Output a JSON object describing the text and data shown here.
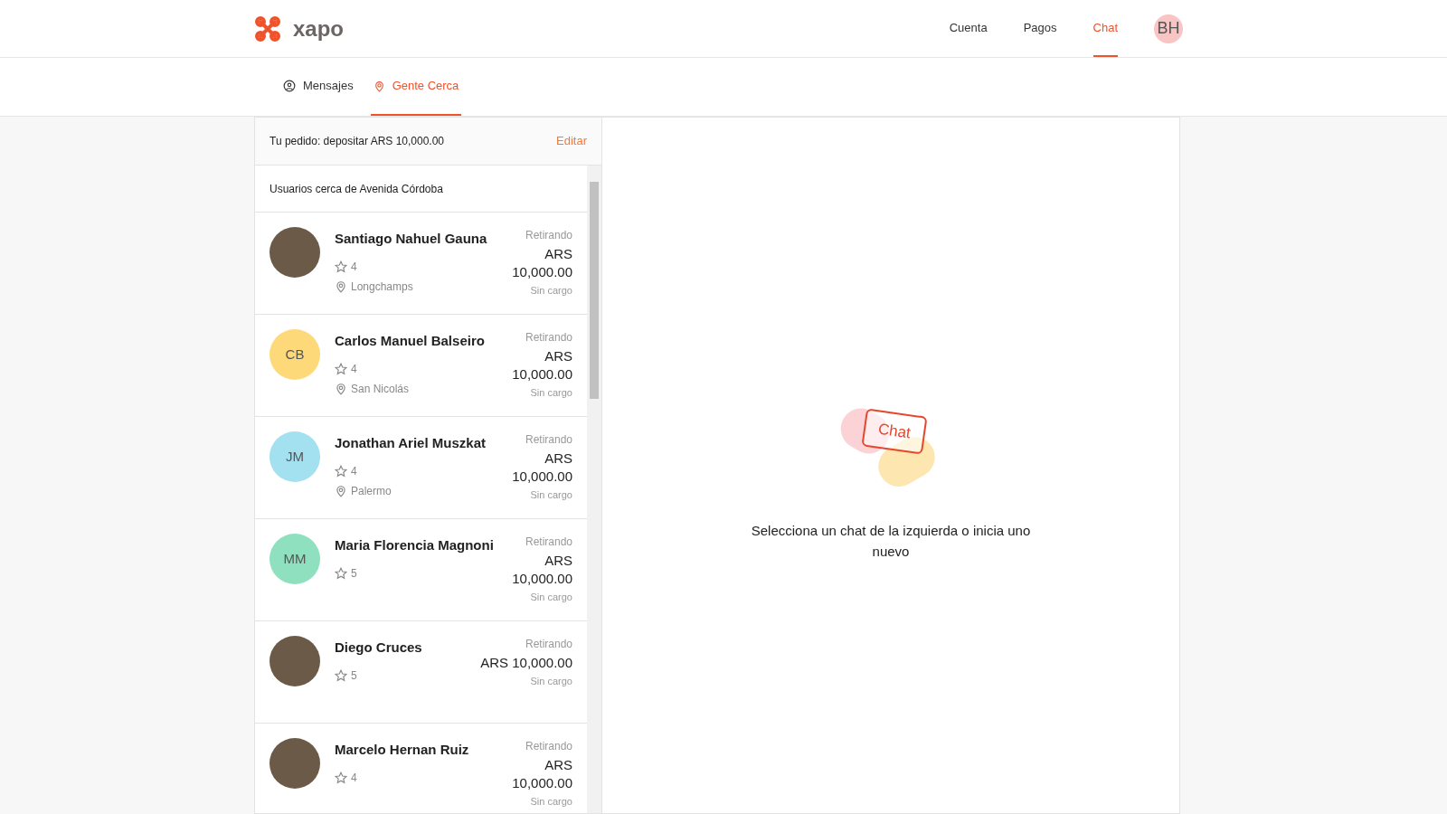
{
  "header": {
    "logo": "xapo",
    "nav": [
      {
        "label": "Cuenta",
        "selected": false
      },
      {
        "label": "Pagos",
        "selected": false
      },
      {
        "label": "Chat",
        "selected": true
      }
    ],
    "avatar": "BH"
  },
  "subnav": [
    {
      "label": "Mensajes",
      "selected": false
    },
    {
      "label": "Gente Cerca",
      "selected": true
    }
  ],
  "order": {
    "text": "Tu pedido: depositar ARS 10,000.00",
    "action": "Editar"
  },
  "nearby_title": "Usuarios cerca de Avenida Córdoba",
  "users": [
    {
      "name": "Santiago Nahuel Gauna",
      "rating": "4",
      "location": "Longchamps",
      "status": "Retirando",
      "amount": "ARS 10,000.00",
      "fee": "Sin cargo"
    },
    {
      "name": "Carlos Manuel Balseiro",
      "initials": "CB",
      "color": "#fdd97a",
      "rating": "4",
      "location": "San Nicolás",
      "status": "Retirando",
      "amount": "ARS 10,000.00",
      "fee": "Sin cargo"
    },
    {
      "name": "Jonathan Ariel Muszkat",
      "initials": "JM",
      "color": "#a3e1f0",
      "rating": "4",
      "location": "Palermo",
      "status": "Retirando",
      "amount": "ARS 10,000.00",
      "fee": "Sin cargo"
    },
    {
      "name": "Maria Florencia Magnoni",
      "initials": "MM",
      "color": "#8ee0bf",
      "rating": "5",
      "status": "Retirando",
      "amount": "ARS 10,000.00",
      "fee": "Sin cargo"
    },
    {
      "name": "Diego Cruces",
      "rating": "5",
      "status": "Retirando",
      "amount": "ARS 10,000.00",
      "fee": "Sin cargo"
    },
    {
      "name": "Marcelo Hernan Ruiz",
      "rating": "4",
      "status": "Retirando",
      "amount": "ARS 10,000.00",
      "fee": "Sin cargo"
    }
  ],
  "empty_state": {
    "illustration_text": "Chat",
    "message": "Selecciona un chat de la izquierda o inicia uno nuevo"
  }
}
